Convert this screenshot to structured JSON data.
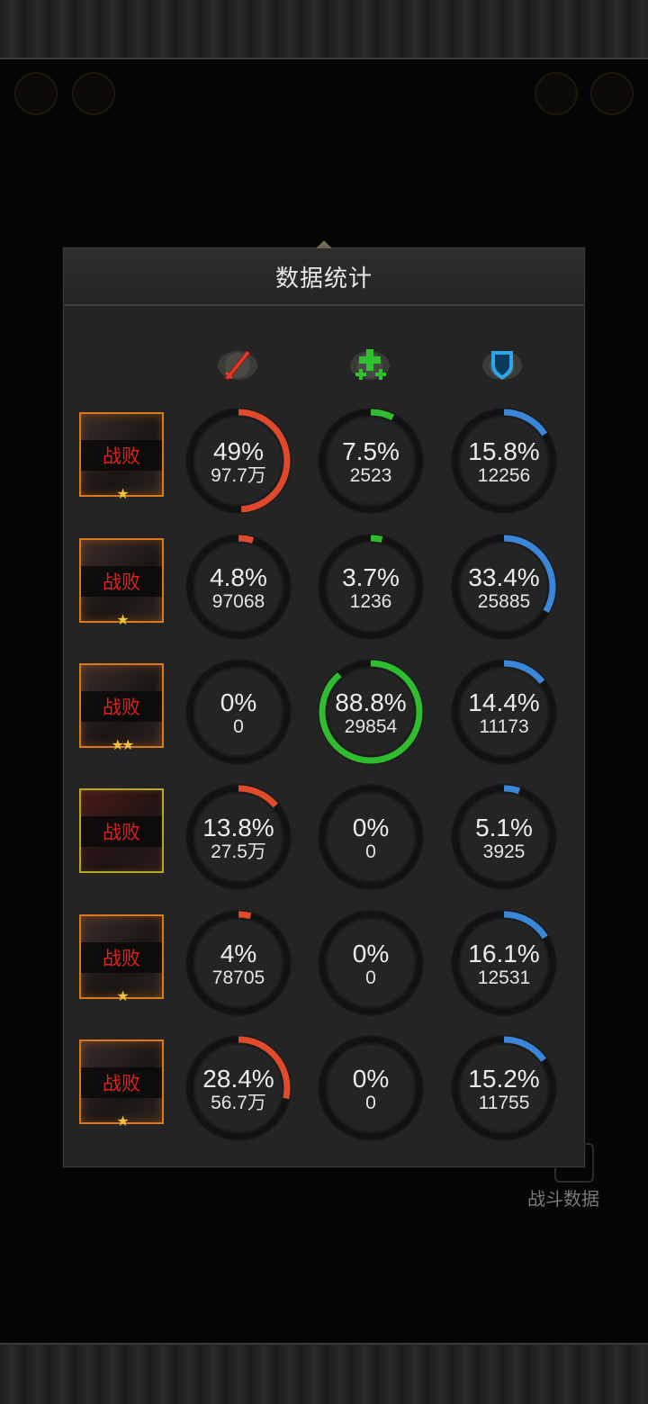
{
  "panel": {
    "title": "数据统计"
  },
  "columns": [
    {
      "icon": "sword-icon",
      "color": "#e23a2a"
    },
    {
      "icon": "heal-cross-icon",
      "color": "#2fc22f"
    },
    {
      "icon": "shield-icon",
      "color": "#2ea6e8"
    }
  ],
  "colors": {
    "damage": "#e04a2a",
    "heal": "#2fbd2f",
    "tank": "#3a86d8",
    "ring_track": "#111211",
    "defeat_text": "#e0211f"
  },
  "heroes": [
    {
      "status": "战败",
      "stars": "★",
      "stats": [
        {
          "pct": "49%",
          "frac": 0.49,
          "value": "97.7万"
        },
        {
          "pct": "7.5%",
          "frac": 0.075,
          "value": "2523"
        },
        {
          "pct": "15.8%",
          "frac": 0.158,
          "value": "12256"
        }
      ]
    },
    {
      "status": "战败",
      "stars": "★",
      "stats": [
        {
          "pct": "4.8%",
          "frac": 0.048,
          "value": "97068"
        },
        {
          "pct": "3.7%",
          "frac": 0.037,
          "value": "1236"
        },
        {
          "pct": "33.4%",
          "frac": 0.334,
          "value": "25885"
        }
      ]
    },
    {
      "status": "战败",
      "stars": "★★",
      "stats": [
        {
          "pct": "0%",
          "frac": 0,
          "value": "0"
        },
        {
          "pct": "88.8%",
          "frac": 0.888,
          "value": "29854"
        },
        {
          "pct": "14.4%",
          "frac": 0.144,
          "value": "11173"
        }
      ]
    },
    {
      "status": "战败",
      "stars": "",
      "stats": [
        {
          "pct": "13.8%",
          "frac": 0.138,
          "value": "27.5万"
        },
        {
          "pct": "0%",
          "frac": 0,
          "value": "0"
        },
        {
          "pct": "5.1%",
          "frac": 0.051,
          "value": "3925"
        }
      ]
    },
    {
      "status": "战败",
      "stars": "★",
      "stats": [
        {
          "pct": "4%",
          "frac": 0.04,
          "value": "78705"
        },
        {
          "pct": "0%",
          "frac": 0,
          "value": "0"
        },
        {
          "pct": "16.1%",
          "frac": 0.161,
          "value": "12531"
        }
      ]
    },
    {
      "status": "战败",
      "stars": "★",
      "stats": [
        {
          "pct": "28.4%",
          "frac": 0.284,
          "value": "56.7万"
        },
        {
          "pct": "0%",
          "frac": 0,
          "value": "0"
        },
        {
          "pct": "15.2%",
          "frac": 0.152,
          "value": "11755"
        }
      ]
    }
  ],
  "background": {
    "battle_data_label": "战斗数据"
  }
}
